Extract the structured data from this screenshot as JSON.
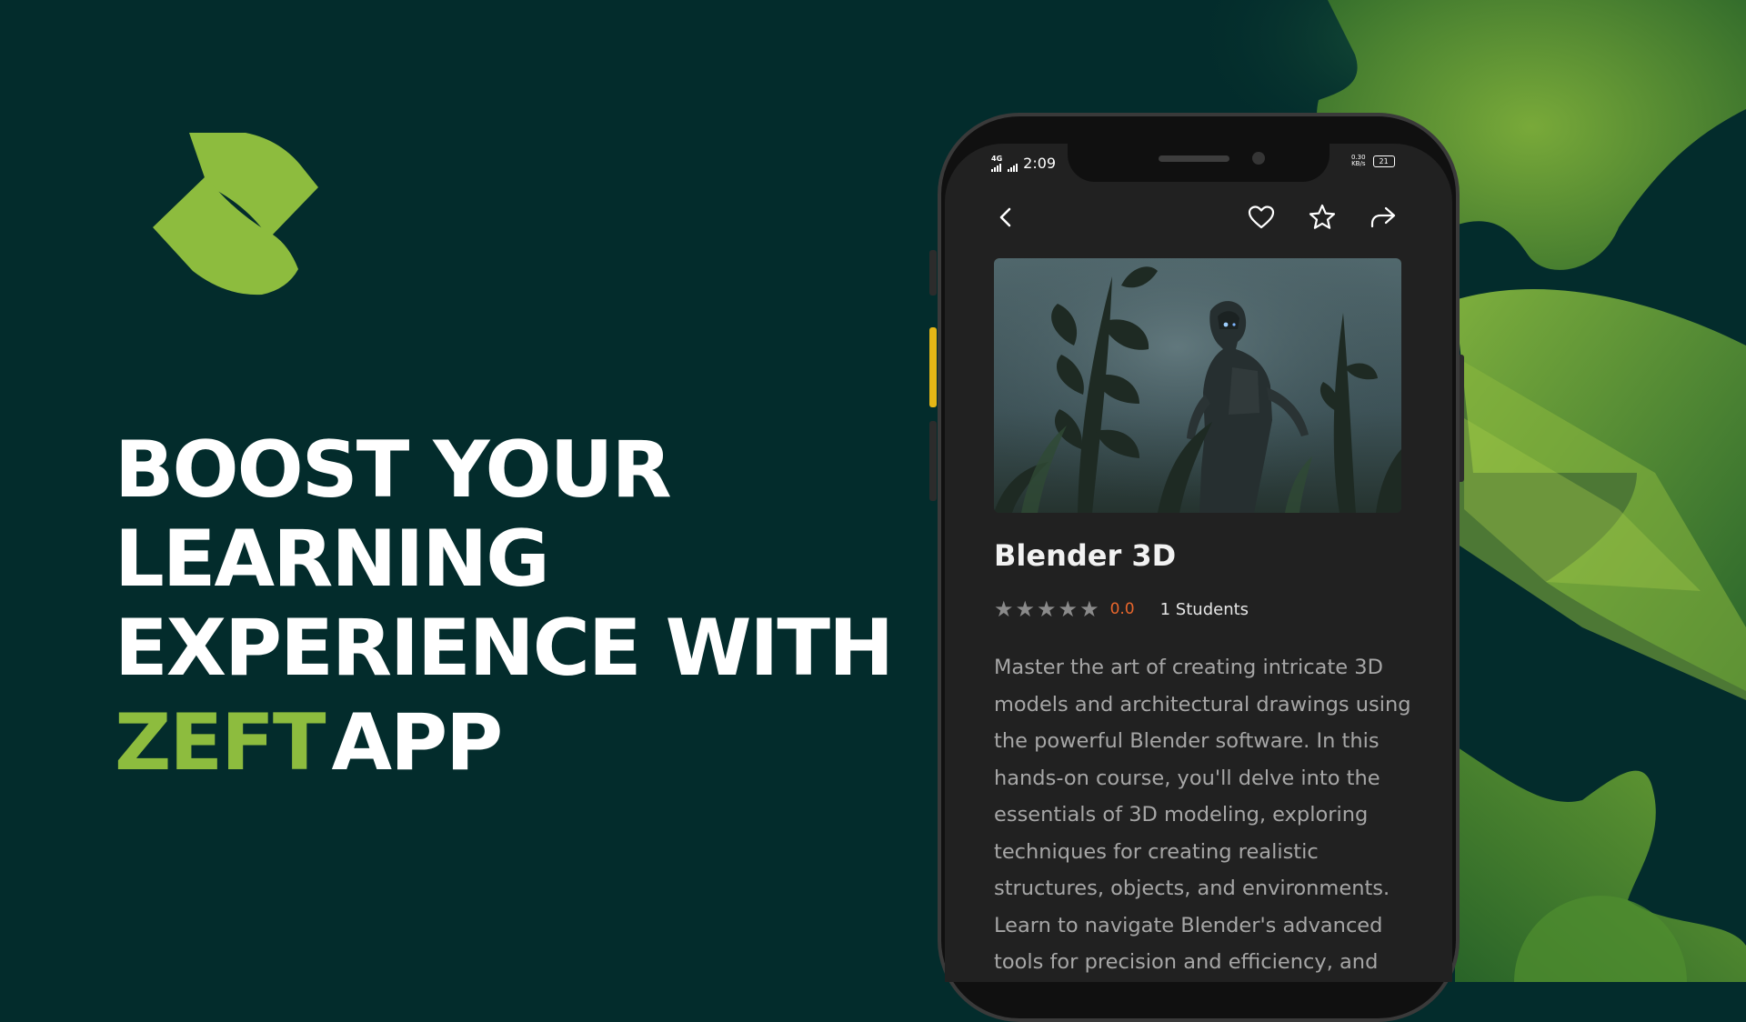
{
  "headline": {
    "line1": "BOOST YOUR",
    "line2": "LEARNING",
    "line3": "EXPERIENCE WITH",
    "brand": "ZEFT",
    "app": "APP"
  },
  "colors": {
    "background": "#032c2c",
    "brand_green": "#8dbc3e",
    "rating_orange": "#e8662c",
    "screen": "#212121"
  },
  "logo": {
    "icon": "zeft-logo-icon"
  },
  "phone": {
    "status_bar": {
      "network": "4G",
      "time": "2:09",
      "speed_value": "0.30",
      "speed_unit": "KB/s",
      "battery": "21"
    },
    "toolbar": {
      "back_icon": "back-chevron-icon",
      "favorite_icon": "heart-icon",
      "rate_icon": "star-outline-icon",
      "share_icon": "share-arrow-icon"
    },
    "course": {
      "title": "Blender 3D",
      "rating_stars": 0,
      "rating_max": 5,
      "rating": "0.0",
      "students": "1 Students",
      "description_lines": [
        "Master the art of creating intricate 3D",
        "models and architectural drawings using",
        "the powerful Blender software. In this",
        "hands-on course, you'll delve into the",
        "essentials of 3D modeling, exploring",
        "techniques for creating realistic",
        "structures, objects, and environments.",
        "Learn to navigate Blender's advanced",
        "tools for precision and efficiency, and"
      ]
    }
  }
}
